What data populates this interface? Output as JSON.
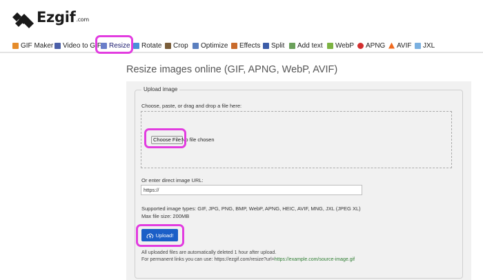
{
  "logo": {
    "name": "Ezgif",
    "suffix": ".com"
  },
  "nav": {
    "items": [
      {
        "label": "GIF Maker",
        "icon": "gif-maker-icon",
        "color": "#e58b2a"
      },
      {
        "label": "Video to GIF",
        "icon": "film-icon",
        "color": "#4b5fa8"
      },
      {
        "label": "Resize",
        "icon": "resize-icon",
        "color": "#6a7ec9",
        "active": true
      },
      {
        "label": "Rotate",
        "icon": "rotate-icon",
        "color": "#4a90d9"
      },
      {
        "label": "Crop",
        "icon": "crop-icon",
        "color": "#7a5e3a"
      },
      {
        "label": "Optimize",
        "icon": "optimize-icon",
        "color": "#5b7fbf"
      },
      {
        "label": "Effects",
        "icon": "effects-icon",
        "color": "#c96b2c"
      },
      {
        "label": "Split",
        "icon": "split-icon",
        "color": "#3c5da8"
      },
      {
        "label": "Add text",
        "icon": "add-text-icon",
        "color": "#6aa05a"
      },
      {
        "label": "WebP",
        "icon": "webp-icon",
        "color": "#7cb342"
      },
      {
        "label": "APNG",
        "icon": "apng-icon",
        "color": "#d32f2f"
      },
      {
        "label": "AVIF",
        "icon": "avif-icon",
        "color": "#f06b20"
      },
      {
        "label": "JXL",
        "icon": "jxl-icon",
        "color": "#7ab0e0"
      }
    ]
  },
  "page": {
    "title": "Resize images online (GIF, APNG, WebP, AVIF)"
  },
  "upload": {
    "legend": "Upload image",
    "choose_label": "Choose, paste, or drag and drop a file here:",
    "choose_button": "Choose File",
    "file_status": "No file chosen",
    "url_label": "Or enter direct image URL:",
    "url_value": "https://",
    "supported": "Supported image types: GIF, JPG, PNG, BMP, WebP, APNG, HEIC, AVIF, MNG, JXL (JPEG XL)",
    "max_size": "Max file size: 200MB",
    "upload_button": "Upload!",
    "note_1": "All uploaded files are automatically deleted 1 hour after upload.",
    "note_2_prefix": "For permanent links you can use: https://ezgif.com/resize?url=",
    "note_2_link": "https://example.com/source-image.gif"
  },
  "colors": {
    "highlight": "#e23ce0",
    "upload_button": "#1b5fc7",
    "panel": "#f1f1f1"
  }
}
